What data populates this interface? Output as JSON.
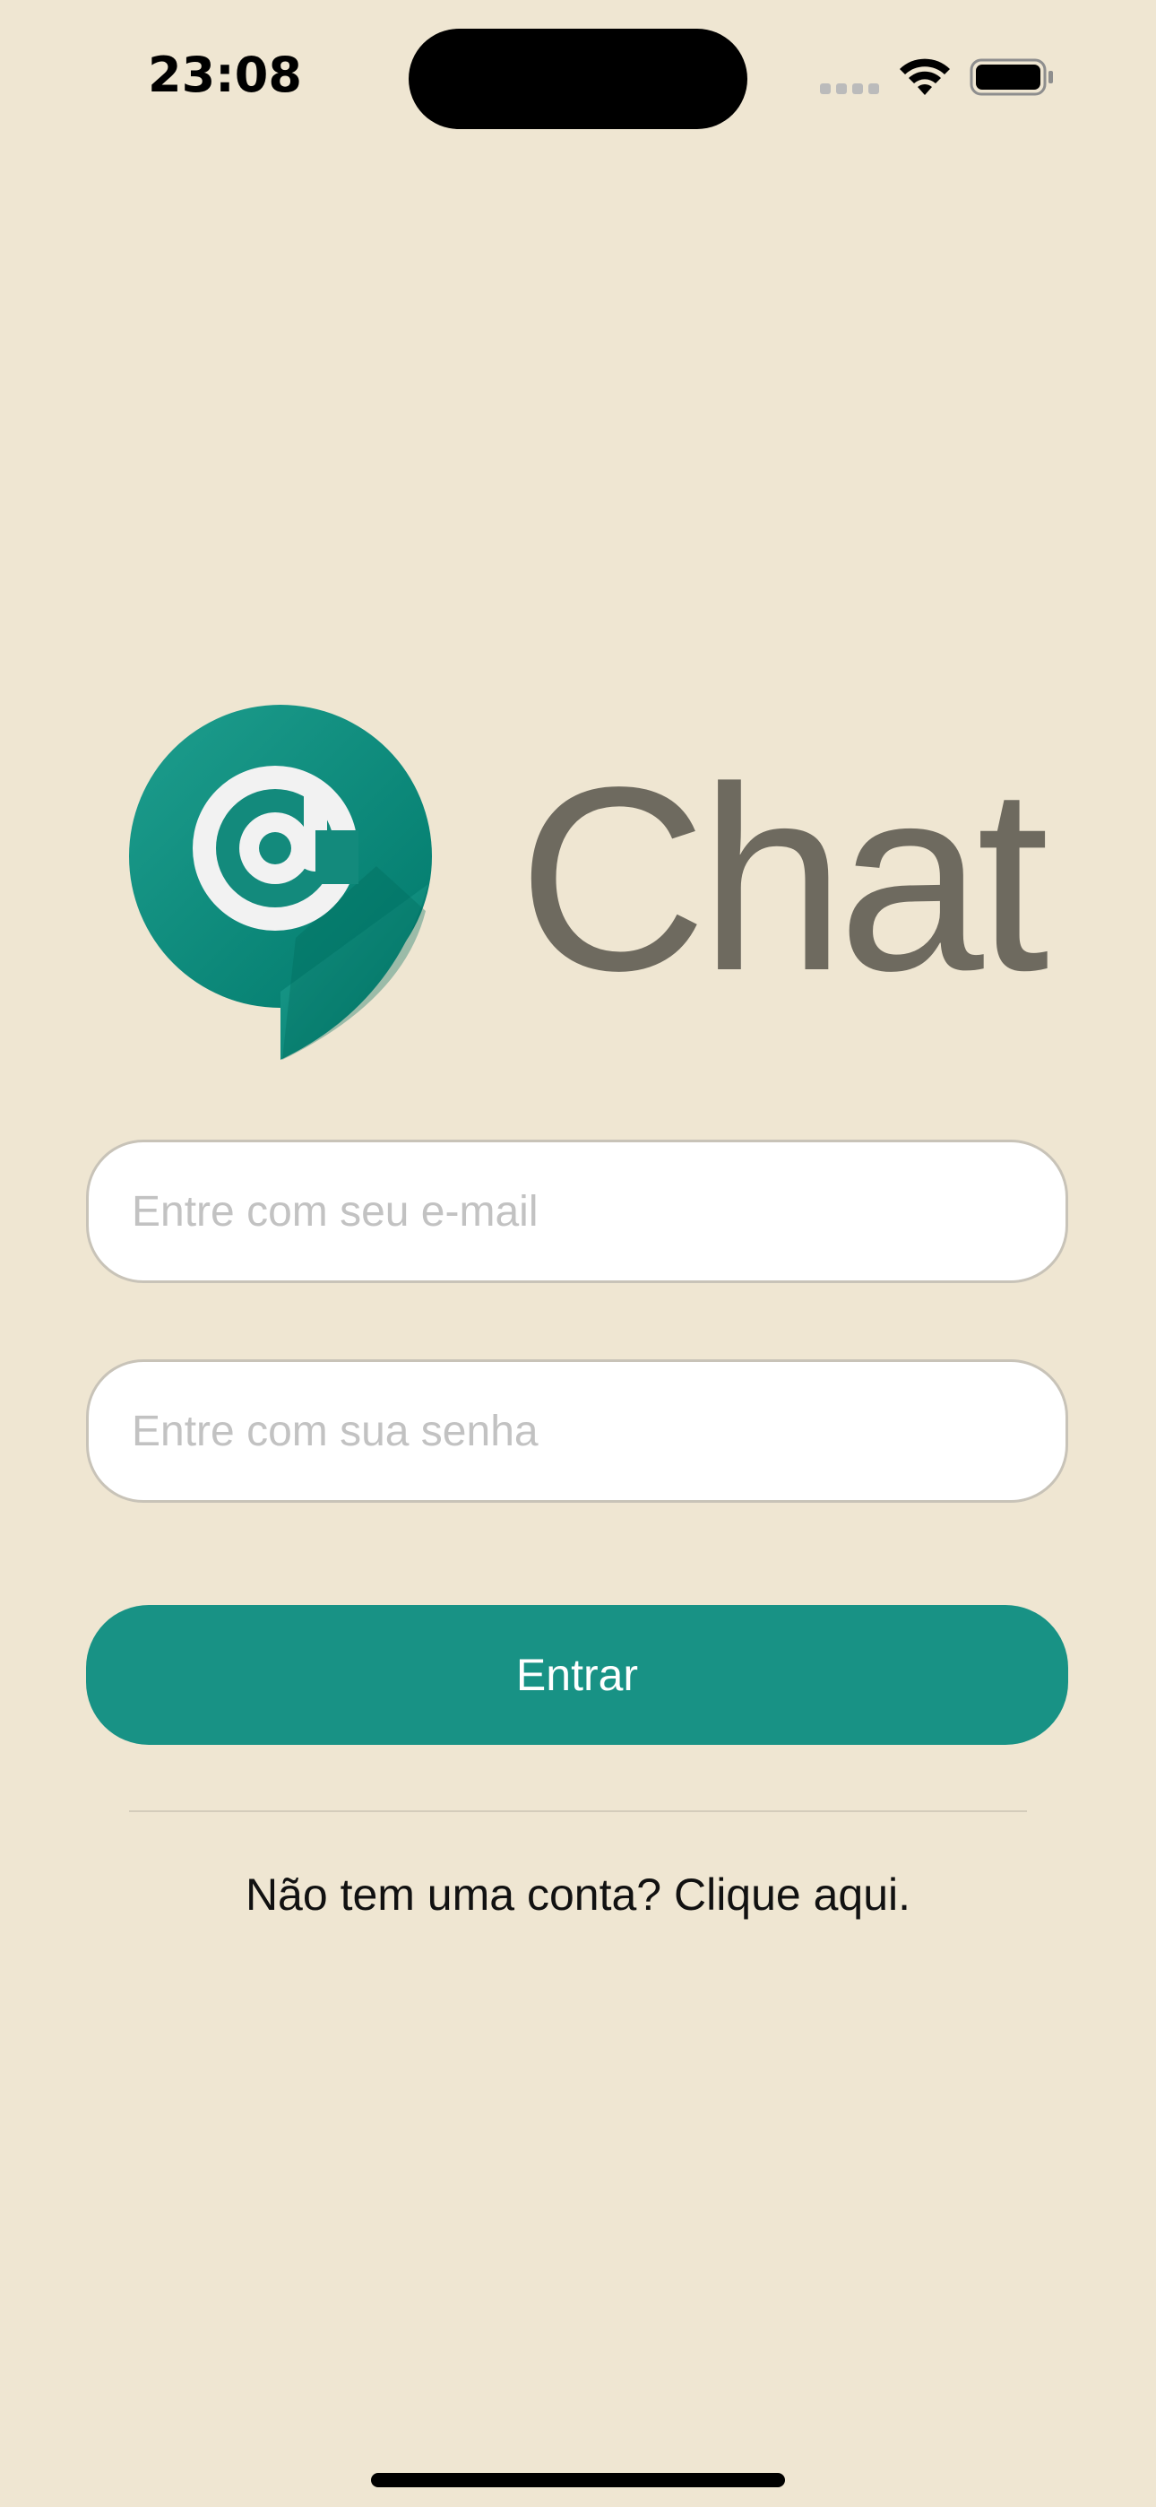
{
  "status_bar": {
    "time": "23:08",
    "icons": [
      "cellular-signal-icon",
      "wifi-icon",
      "battery-icon"
    ]
  },
  "logo": {
    "icon": "at-sign-chat-bubble-icon",
    "text": "Chat"
  },
  "form": {
    "email_placeholder": "Entre com seu e-mail",
    "email_value": "",
    "password_placeholder": "Entre com sua senha",
    "password_value": "",
    "submit_label": "Entrar"
  },
  "signup": {
    "text": "Não tem uma conta? Clique aqui."
  },
  "colors": {
    "background": "#EFE6D2",
    "accent": "#189285",
    "logo_text": "#6E6A5F"
  }
}
